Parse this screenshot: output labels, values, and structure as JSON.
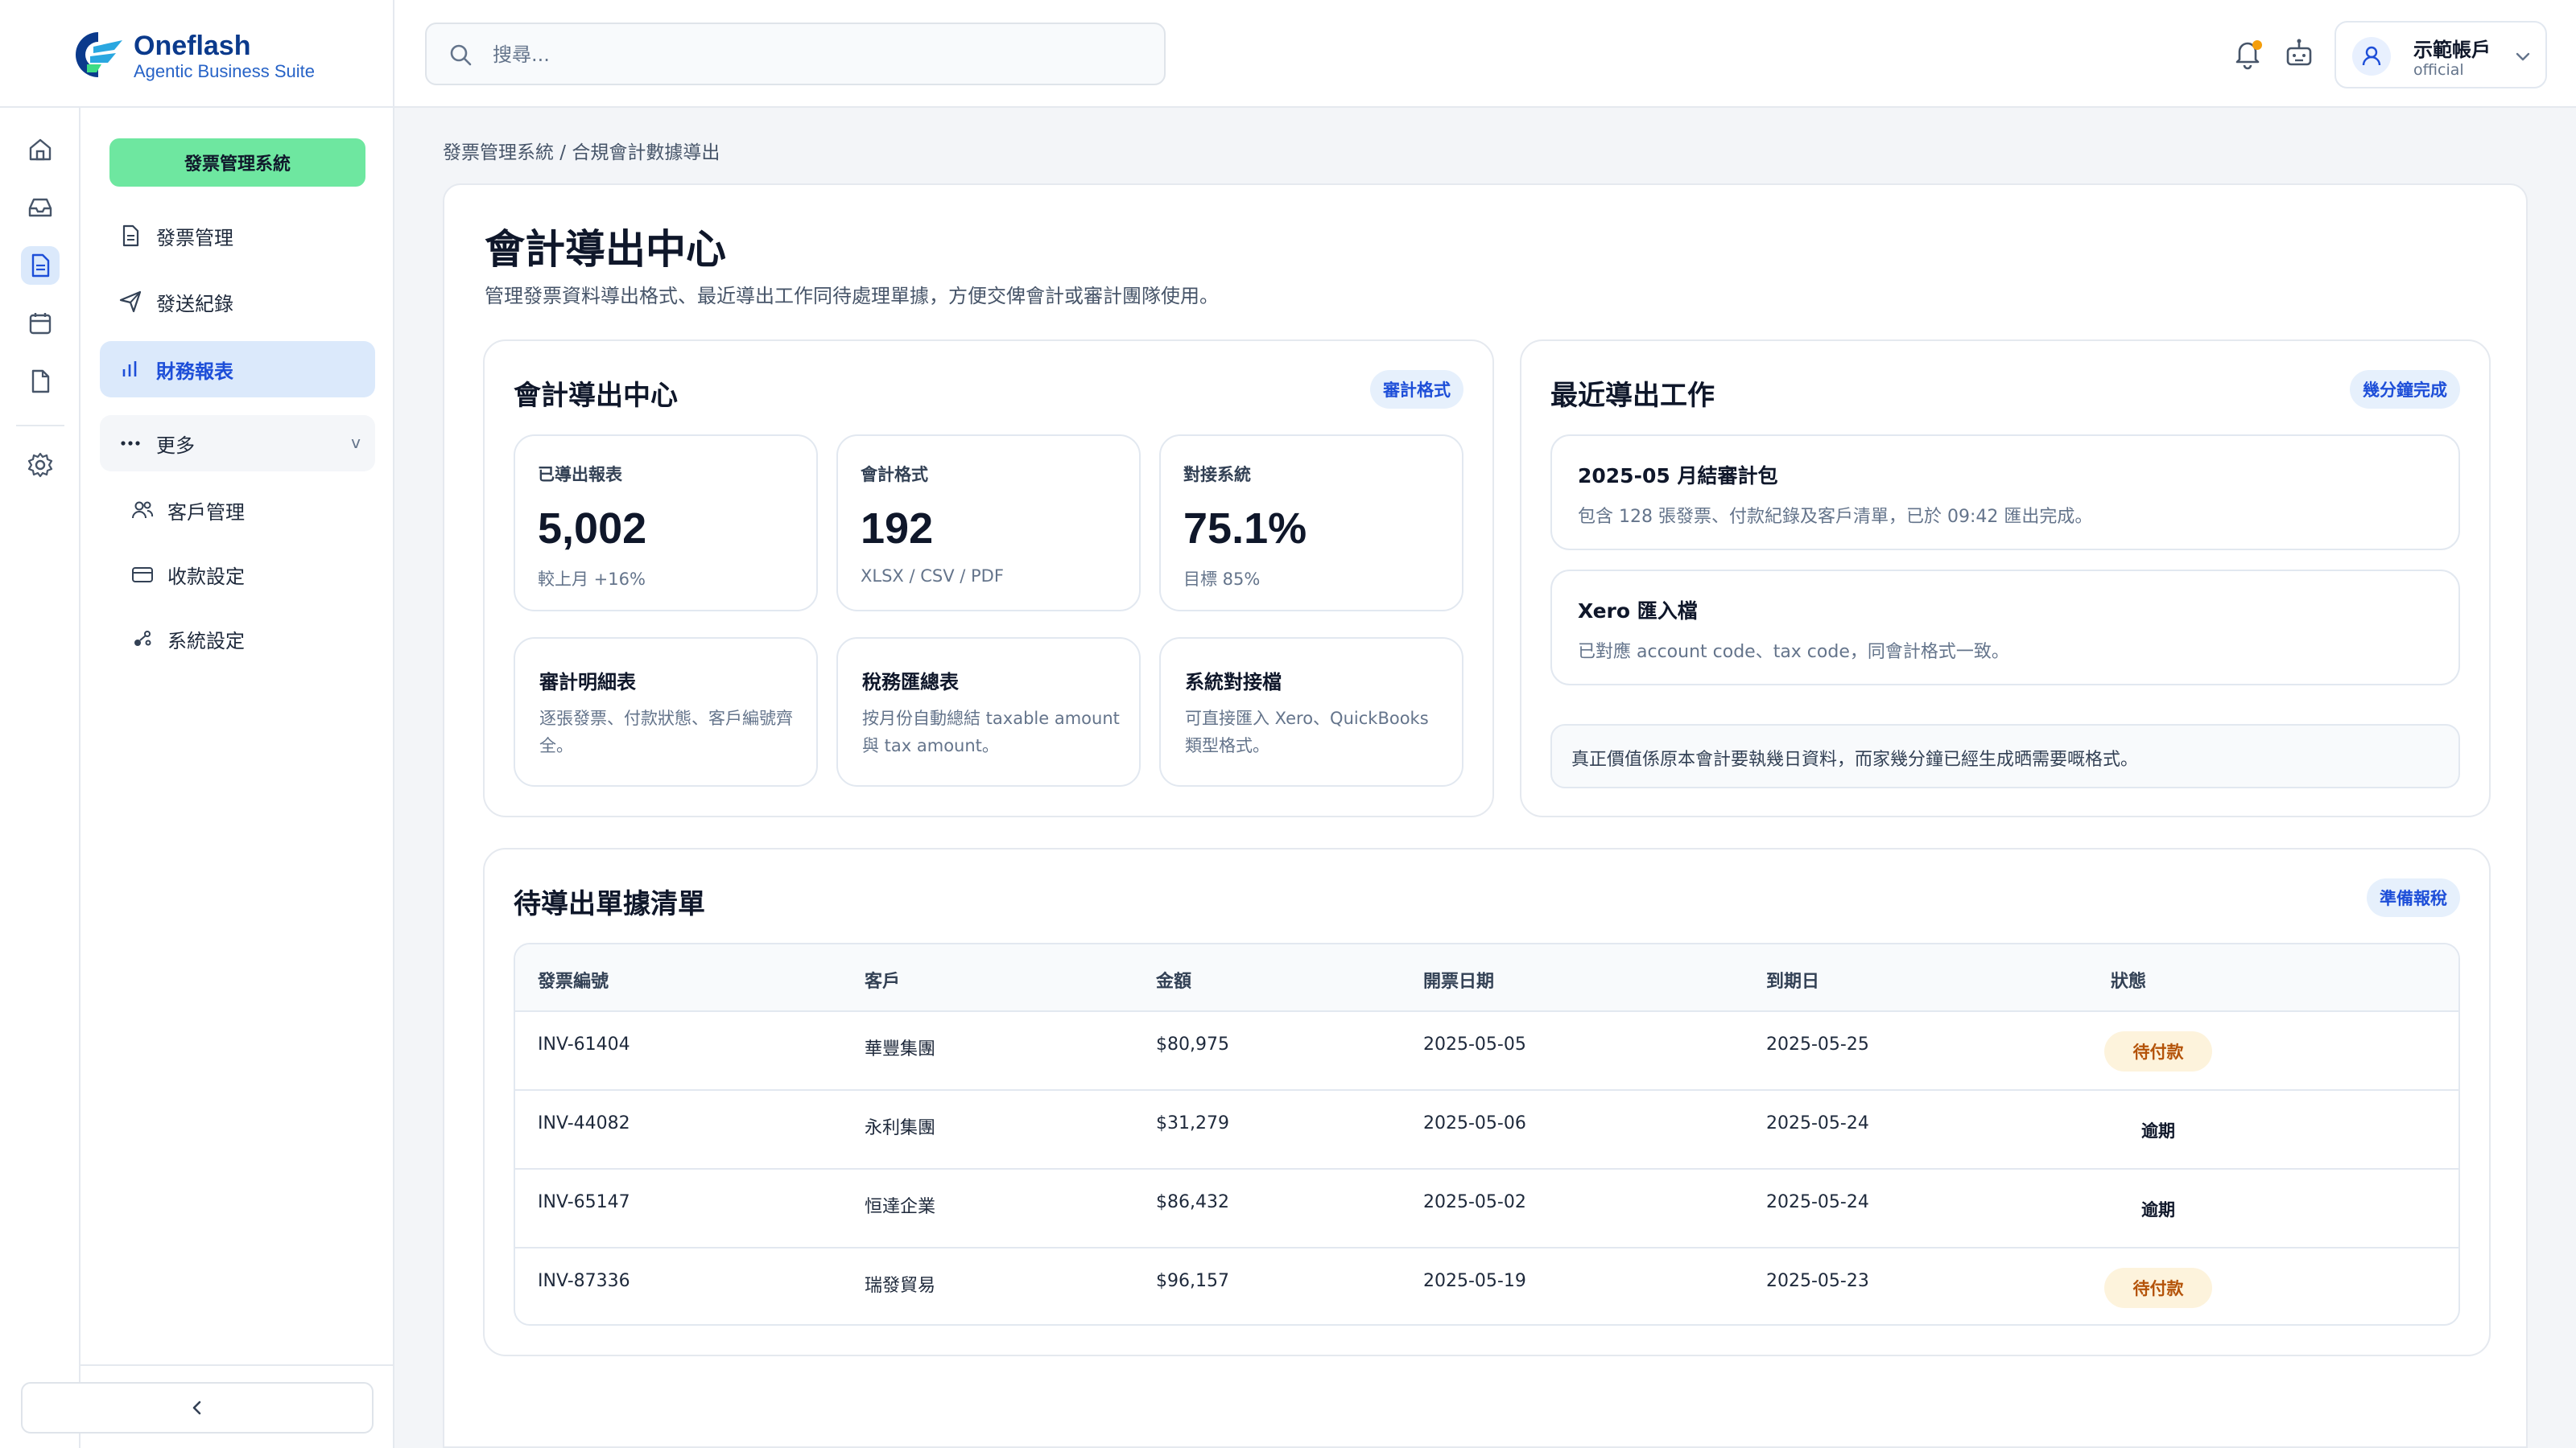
{
  "brand": {
    "name": "Oneflash",
    "tagline": "Agentic Business Suite"
  },
  "search": {
    "placeholder": "搜尋..."
  },
  "account": {
    "name": "示範帳戶",
    "role": "official"
  },
  "sidebar": {
    "module_button": "發票管理系統",
    "items": [
      {
        "label": "發票管理",
        "icon": "document-icon"
      },
      {
        "label": "發送紀錄",
        "icon": "send-icon"
      },
      {
        "label": "財務報表",
        "icon": "bar-chart-icon",
        "active": true
      }
    ],
    "more": {
      "label": "更多",
      "chevron": "v"
    },
    "sub_items": [
      {
        "label": "客戶管理",
        "icon": "users-icon"
      },
      {
        "label": "收款設定",
        "icon": "card-icon"
      },
      {
        "label": "系統設定",
        "icon": "settings-nodes-icon"
      }
    ]
  },
  "breadcrumb": "發票管理系統 / 合規會計數據導出",
  "page": {
    "title": "會計導出中心",
    "description": "管理發票資料導出格式、最近導出工作同待處理單據，方便交俾會計或審計團隊使用。"
  },
  "export_panel": {
    "title": "會計導出中心",
    "badge": "審計格式",
    "stats": [
      {
        "label": "已導出報表",
        "value": "5,002",
        "note": "較上月 +16%"
      },
      {
        "label": "會計格式",
        "value": "192",
        "note": "XLSX / CSV / PDF"
      },
      {
        "label": "對接系統",
        "value": "75.1%",
        "note": "目標 85%"
      }
    ],
    "features": [
      {
        "title": "審計明細表",
        "desc": "逐張發票、付款狀態、客戶編號齊全。"
      },
      {
        "title": "稅務匯總表",
        "desc": "按月份自動總結 taxable amount 與 tax amount。"
      },
      {
        "title": "系統對接檔",
        "desc": "可直接匯入 Xero、QuickBooks 類型格式。"
      }
    ]
  },
  "jobs_panel": {
    "title": "最近導出工作",
    "badge": "幾分鐘完成",
    "jobs": [
      {
        "title": "2025-05 月結審計包",
        "desc": "包含 128 張發票、付款紀錄及客戶清單，已於 09:42 匯出完成。"
      },
      {
        "title": "Xero 匯入檔",
        "desc": "已對應 account code、tax code，同會計格式一致。"
      }
    ],
    "note": "真正價值係原本會計要執幾日資料，而家幾分鐘已經生成晒需要嘅格式。"
  },
  "pending_panel": {
    "title": "待導出單據清單",
    "badge": "準備報稅",
    "columns": [
      "發票編號",
      "客戶",
      "金額",
      "開票日期",
      "到期日",
      "狀態"
    ],
    "rows": [
      {
        "id": "INV-61404",
        "client": "華豐集團",
        "amount": "$80,975",
        "issued": "2025-05-05",
        "due": "2025-05-25",
        "status": "待付款",
        "kind": "pending"
      },
      {
        "id": "INV-44082",
        "client": "永利集團",
        "amount": "$31,279",
        "issued": "2025-05-06",
        "due": "2025-05-24",
        "status": "逾期",
        "kind": "overdue"
      },
      {
        "id": "INV-65147",
        "client": "恒達企業",
        "amount": "$86,432",
        "issued": "2025-05-02",
        "due": "2025-05-24",
        "status": "逾期",
        "kind": "overdue"
      },
      {
        "id": "INV-87336",
        "client": "瑞發貿易",
        "amount": "$96,157",
        "issued": "2025-05-19",
        "due": "2025-05-23",
        "status": "待付款",
        "kind": "pending"
      }
    ]
  },
  "colors": {
    "accent": "#1d4ed8",
    "module_green": "#6ee7a0",
    "pending_bg": "#fdf3dc",
    "pending_text": "#b45309",
    "notification_dot": "#f59e0b"
  }
}
